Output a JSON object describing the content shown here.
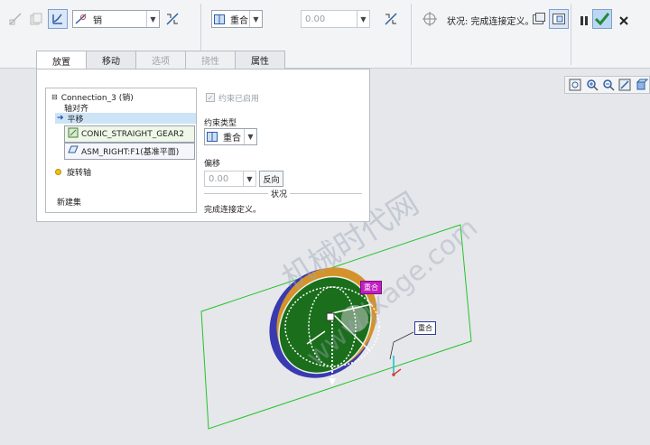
{
  "toolbar": {
    "connection_type": "销",
    "constraint_type": "重合",
    "offset_value": "0.00",
    "status": "状况: 完成连接定义。"
  },
  "tabs": [
    {
      "label": "放置"
    },
    {
      "label": "移动"
    },
    {
      "label": "选项"
    },
    {
      "label": "挠性"
    },
    {
      "label": "属性"
    }
  ],
  "panel": {
    "tree": {
      "connection": "Connection_3 (销)",
      "axis_align": "轴对齐",
      "translation": "平移",
      "ref1": "CONIC_STRAIGHT_GEAR2",
      "ref2": "ASM_RIGHT:F1(基准平面)",
      "rotation_axis": "旋转轴",
      "new_set": "新建集"
    },
    "constraint_enabled": "约束已启用",
    "constraint_type_label": "约束类型",
    "constraint_type_value": "重合",
    "offset_label": "偏移",
    "offset_value": "0.00",
    "flip_button": "反向",
    "status_label": "状况",
    "status_value": "完成连接定义。"
  },
  "canvas": {
    "tag1": "重合",
    "tag2": "重合",
    "watermark1": "机械时代网",
    "watermark2": "www.jxage.com"
  },
  "colors": {
    "accent": "#4a8fd6",
    "confirm_green": "#1e8c3a",
    "plane_green": "#21c42b",
    "gear_green": "#1b6e1b",
    "tag_magenta": "#c21fc2"
  }
}
